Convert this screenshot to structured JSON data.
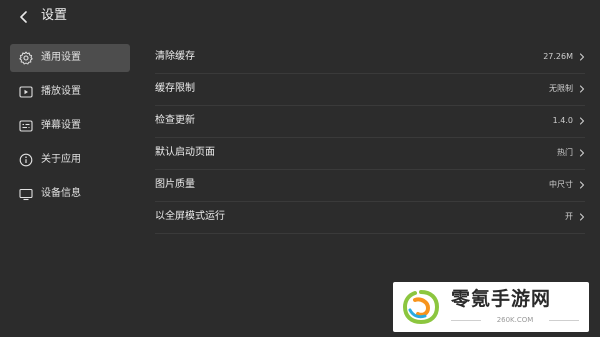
{
  "header": {
    "title": "设置",
    "back_icon": "chevron-left-icon"
  },
  "sidebar": {
    "items": [
      {
        "label": "通用设置",
        "icon": "gear-icon",
        "active": true
      },
      {
        "label": "播放设置",
        "icon": "play-icon",
        "active": false
      },
      {
        "label": "弹幕设置",
        "icon": "danmaku-icon",
        "active": false
      },
      {
        "label": "关于应用",
        "icon": "info-icon",
        "active": false
      },
      {
        "label": "设备信息",
        "icon": "monitor-icon",
        "active": false
      }
    ]
  },
  "settings": {
    "rows": [
      {
        "label": "清除缓存",
        "value": "27.26M"
      },
      {
        "label": "缓存限制",
        "value": "无限制"
      },
      {
        "label": "检查更新",
        "value": "1.4.0"
      },
      {
        "label": "默认启动页面",
        "value": "热门"
      },
      {
        "label": "图片质量",
        "value": "中尺寸"
      },
      {
        "label": "以全屏模式运行",
        "value": "开"
      }
    ]
  },
  "watermark": {
    "brand": "零氪手游网",
    "url": "260K.COM"
  },
  "colors": {
    "background": "#2c2c2c",
    "active_item": "#4d4d4d",
    "divider": "#3a3a3a"
  }
}
